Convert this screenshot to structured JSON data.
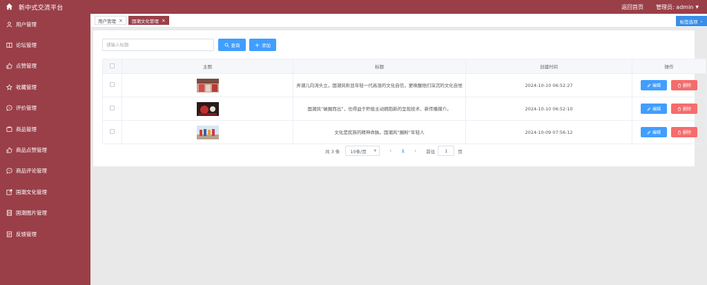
{
  "header": {
    "app_title": "新中式交流平台",
    "back_home": "返回首页",
    "admin_label": "管理员: admin"
  },
  "sidebar": {
    "items": [
      {
        "label": "用户管理",
        "icon": "user-icon"
      },
      {
        "label": "论坛管理",
        "icon": "book-icon"
      },
      {
        "label": "点赞管理",
        "icon": "thumbs-up-icon"
      },
      {
        "label": "收藏管理",
        "icon": "star-icon"
      },
      {
        "label": "评价管理",
        "icon": "comment-icon"
      },
      {
        "label": "商品管理",
        "icon": "cart-icon"
      },
      {
        "label": "商品点赞管理",
        "icon": "thumbs-up-icon"
      },
      {
        "label": "商品评论管理",
        "icon": "comment-icon"
      },
      {
        "label": "国潮文化管理",
        "icon": "share-icon"
      },
      {
        "label": "国潮图片管理",
        "icon": "film-icon"
      },
      {
        "label": "反馈管理",
        "icon": "document-icon"
      }
    ]
  },
  "tags": [
    {
      "label": "用户管理",
      "active": false
    },
    {
      "label": "国潮文化管理",
      "active": true
    }
  ],
  "tag_options_label": "标签选项",
  "search": {
    "placeholder": "请输入标题",
    "query_label": "查询",
    "add_label": "添加"
  },
  "table": {
    "headers": [
      "主图",
      "标题",
      "创建时间",
      "操作"
    ],
    "rows": [
      {
        "title": "弄潮儿向涛头立，国潮风彰显年轻一代高涨的文化自信，更唤醒他们深沉的文化自觉",
        "created": "2024-10-10 06:52:27"
      },
      {
        "title": "国潮风“破圈而出”，也得益于积极主动拥抱新的呈现技术、新传播媒介。",
        "created": "2024-10-10 06:52:10"
      },
      {
        "title": "文化是民族的精神命脉。国潮风“圈粉”年轻人",
        "created": "2024-10-09 07:56:12"
      }
    ],
    "edit_label": "编辑",
    "delete_label": "删除"
  },
  "pagination": {
    "total": "共 3 条",
    "page_size": "10条/页",
    "current": "1",
    "goto_label": "前往",
    "goto_value": "1",
    "unit": "页"
  },
  "colors": {
    "brand": "#9a3f48",
    "primary": "#409eff",
    "danger": "#f56c6c"
  }
}
